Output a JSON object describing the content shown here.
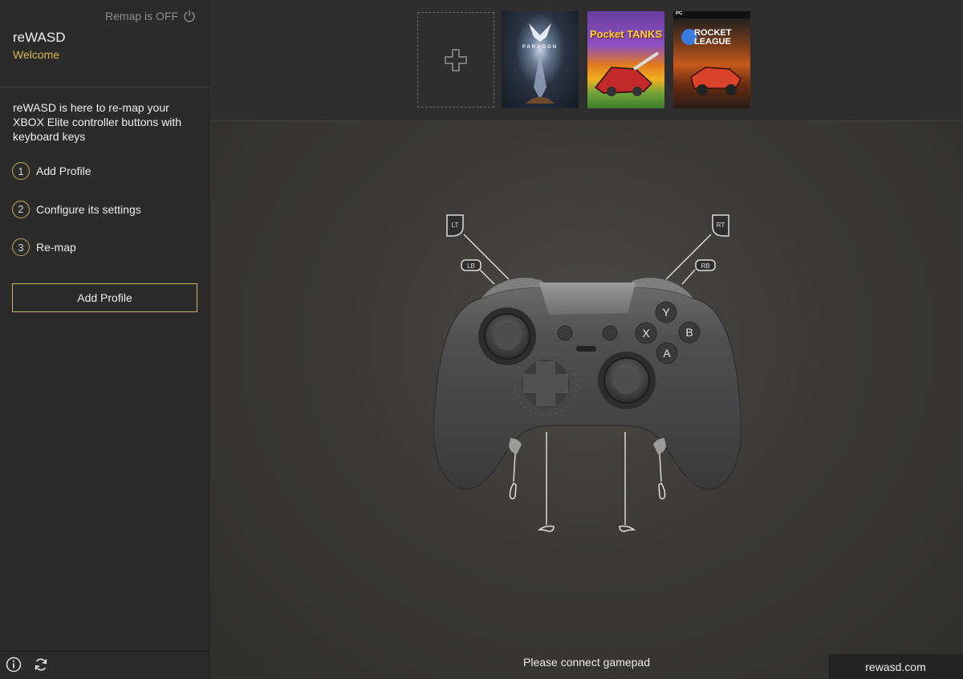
{
  "sidebar": {
    "remap_status": "Remap is OFF",
    "app_title": "reWASD",
    "app_subtitle": "Welcome",
    "intro": "reWASD is here to re-map your XBOX Elite controller buttons with keyboard keys",
    "steps": [
      {
        "num": "1",
        "label": "Add Profile"
      },
      {
        "num": "2",
        "label": "Configure its settings"
      },
      {
        "num": "3",
        "label": "Re-map"
      }
    ],
    "add_profile_label": "Add Profile",
    "bottom_icons": [
      "info-icon",
      "refresh-icon"
    ]
  },
  "games": [
    {
      "name": "Paragon",
      "cover_text": "PARAGON"
    },
    {
      "name": "Pocket Tanks",
      "cover_text": "Pocket TANKS"
    },
    {
      "name": "Rocket League",
      "cover_text": "ROCKET LEAGUE",
      "badge": "PC"
    }
  ],
  "controller": {
    "labels": {
      "lt": "LT",
      "rt": "RT",
      "lb": "LB",
      "rb": "RB"
    },
    "face_buttons": {
      "y": "Y",
      "x": "X",
      "b": "B",
      "a": "A"
    }
  },
  "status": "Please connect gamepad",
  "site": "rewasd.com",
  "colors": {
    "accent": "#d6b84f",
    "background": "#2f2f2f"
  }
}
